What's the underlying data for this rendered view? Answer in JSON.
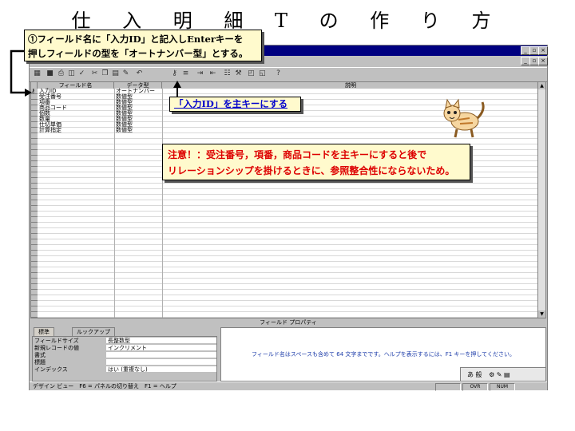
{
  "slide": {
    "title": "仕 入 明 細 T の 作 り 方"
  },
  "window": {
    "controls": {
      "minimize": "_",
      "maximize": "▫",
      "close": "×"
    }
  },
  "grid": {
    "header": {
      "field_name": "フィールド名",
      "data_type": "データ型",
      "description": "説明"
    },
    "rows": [
      {
        "name": "入力ID",
        "type": "オートナンバー",
        "key": true
      },
      {
        "name": "受注番号",
        "type": "数値型"
      },
      {
        "name": "項番",
        "type": "数値型"
      },
      {
        "name": "商品コード",
        "type": "数値型"
      },
      {
        "name": "個数",
        "type": "数値型"
      },
      {
        "name": "数量",
        "type": "数値型"
      },
      {
        "name": "仕切単価",
        "type": "数値型"
      },
      {
        "name": "計算指定",
        "type": "数値型"
      }
    ]
  },
  "properties": {
    "header": "フィールド プロパティ",
    "tabs": [
      "標準",
      "ルックアップ"
    ],
    "rows": [
      {
        "label": "フィールドサイズ",
        "value": "長整数型"
      },
      {
        "label": "新規レコードの値",
        "value": "インクリメント"
      },
      {
        "label": "書式",
        "value": ""
      },
      {
        "label": "標題",
        "value": ""
      },
      {
        "label": "インデックス",
        "value": "はい (重複なし)"
      }
    ],
    "help": "フィールド名はスペースも含めて 64 文字までです。ヘルプを表示するには、F1 キーを押してください。"
  },
  "statusbar": {
    "text": "デザイン ビュー　F6 = パネルの切り替え　F1 = ヘルプ",
    "indicators": [
      "OVR",
      "NUM"
    ]
  },
  "ime": {
    "label": "あ 般"
  },
  "callouts": {
    "c1_line1": "①フィールド名に「入力ID」と記入しEnterキーを",
    "c1_line2": "押しフィールドの型を「オートナンバー型」とする。",
    "c2": "「入力ID」を主キーにする",
    "c3_line1": "注意！：受注番号，項番，商品コードを主キーにすると後で",
    "c3_line2": "リレーションシップを掛けるときに、参照整合性にならないため。"
  },
  "colors": {
    "title_bar": "#000080",
    "callout_bg": "#fffacd",
    "warning_text": "#dd0000",
    "link_text": "#0000cc"
  }
}
